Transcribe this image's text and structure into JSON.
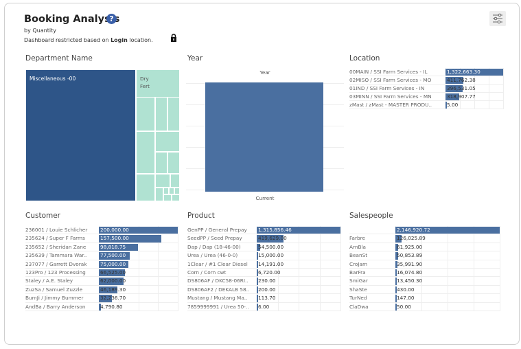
{
  "header": {
    "title": "Booking Analysis",
    "help_glyph": "?",
    "subtitle": "by Quantity",
    "restriction_prefix": "Dashboard restricted based on ",
    "restriction_bold": "Login",
    "restriction_suffix": " location.",
    "icons": [
      "help-icon",
      "lock-icon",
      "filter-settings-icon"
    ]
  },
  "colors": {
    "bar": "#4a6fa0",
    "dept_main": "#2e5588",
    "dept_minor": "#b0e2d2"
  },
  "department": {
    "title": "Department Name",
    "labels": [
      "Miscellaneous -00",
      "Dry",
      "Fert"
    ]
  },
  "year": {
    "title": "Year",
    "column_header": "Year",
    "category": "Current"
  },
  "location": {
    "title": "Location",
    "rows": [
      {
        "label": "00MAIN / SSI Farm Services - IL",
        "value": "1,322,663.30",
        "num": 1322663.3
      },
      {
        "label": "02MISO / SSI Farm Services - MO",
        "value": "411,762.38",
        "num": 411762.38
      },
      {
        "label": "01IND / SSI Farm Services - IN",
        "value": "396,531.05",
        "num": 396531.05
      },
      {
        "label": "03MINN / SSI Farm Services - MN",
        "value": "318,907.77",
        "num": 318907.77
      },
      {
        "label": "zMast / zMast - MASTER PRODU..",
        "value": "5.00",
        "num": 5.0
      }
    ]
  },
  "customer": {
    "title": "Customer",
    "rows": [
      {
        "label": "236001 / Louie Schlicher",
        "value": "200,000.00",
        "num": 200000.0
      },
      {
        "label": "235624 / Super F Farms",
        "value": "157,500.00",
        "num": 157500.0
      },
      {
        "label": "235652 / Sheridan Zane",
        "value": "98,818.75",
        "num": 98818.75
      },
      {
        "label": "235639 / Tammara War..",
        "value": "77,500.00",
        "num": 77500.0
      },
      {
        "label": "237077 / Garrett Dvorak",
        "value": "75,000.00",
        "num": 75000.0
      },
      {
        "label": "123Pro / 123 Processing",
        "value": "66,525.00",
        "num": 66525.0
      },
      {
        "label": "Staley / A.E. Staley",
        "value": "62,000.00",
        "num": 62000.0
      },
      {
        "label": "ZuzSa / Samuel Zuzzle",
        "value": "46,189.30",
        "num": 46189.3
      },
      {
        "label": "BumJi / Jimmy Bummer",
        "value": "32,236.70",
        "num": 32236.7
      },
      {
        "label": "AndBa / Barry Anderson",
        "value": "4,790.80",
        "num": 4790.8
      }
    ]
  },
  "product": {
    "title": "Product",
    "rows": [
      {
        "label": "GenPP / General Prepay",
        "value": "1,315,856.46",
        "num": 1315856.46
      },
      {
        "label": "SeedPP / Seed Prepay",
        "value": "419,629.00",
        "num": 419629.0
      },
      {
        "label": "Dap / Dap (18-46-00)",
        "value": "54,500.00",
        "num": 54500.0
      },
      {
        "label": "Urea / Urea (46-0-0)",
        "value": "15,000.00",
        "num": 15000.0
      },
      {
        "label": "1Clear / #1 Clear Diesel",
        "value": "14,191.00",
        "num": 14191.0
      },
      {
        "label": "Corn / Corn cwt",
        "value": "6,720.00",
        "num": 6720.0
      },
      {
        "label": "DS806AF / DKC58-06RI..",
        "value": "230.00",
        "num": 230.0
      },
      {
        "label": "DS806AF2 / DEKALB 58..",
        "value": "200.00",
        "num": 200.0
      },
      {
        "label": "Mustang / Mustang Ma..",
        "value": "113.70",
        "num": 113.7
      },
      {
        "label": "7859999991 / Urea 50-..",
        "value": "6.00",
        "num": 6.0
      }
    ]
  },
  "salespeople": {
    "title": "Salespeople",
    "rows": [
      {
        "label": "",
        "value": "2,146,920.72",
        "num": 2146920.72
      },
      {
        "label": "Farbre",
        "value": "126,025.89",
        "num": 126025.89
      },
      {
        "label": "ArnBla",
        "value": "61,925.00",
        "num": 61925.0
      },
      {
        "label": "BeanSt",
        "value": "50,853.89",
        "num": 50853.89
      },
      {
        "label": "CroJam",
        "value": "35,991.90",
        "num": 35991.9
      },
      {
        "label": "BarFra",
        "value": "16,074.80",
        "num": 16074.8
      },
      {
        "label": "SmiGar",
        "value": "13,450.30",
        "num": 13450.3
      },
      {
        "label": "ShaSte",
        "value": "430.00",
        "num": 430.0
      },
      {
        "label": "TurNed",
        "value": "147.00",
        "num": 147.0
      },
      {
        "label": "ClaDwa",
        "value": "50.00",
        "num": 50.0
      }
    ]
  }
}
